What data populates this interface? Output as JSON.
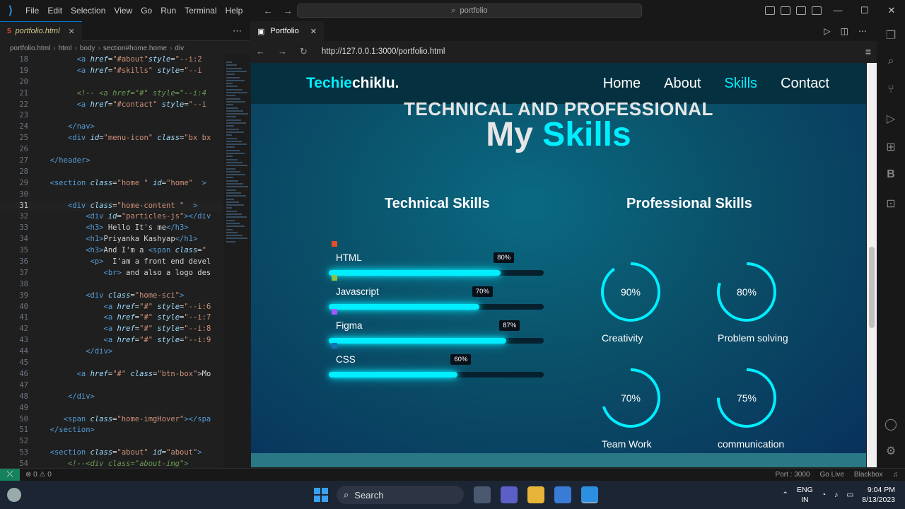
{
  "titlebar": {
    "menu": [
      "File",
      "Edit",
      "Selection",
      "View",
      "Go",
      "Run",
      "Terminal",
      "Help"
    ],
    "search": "portfolio",
    "controls": [
      "—",
      "☐",
      "✕"
    ]
  },
  "editor": {
    "tab": "portfolio.html",
    "breadcrumb": [
      "portfolio.html",
      "html",
      "body",
      "section#home.home",
      "div"
    ],
    "lines": [
      {
        "n": "18",
        "html": "        <span class='tg'>&lt;a</span> <span class='at'>href</span>=<span class='st'>\"#about\"</span><span class='at'>style</span>=<span class='st'>\"--i:2</span>"
      },
      {
        "n": "19",
        "html": "        <span class='tg'>&lt;a</span> <span class='at'>href</span>=<span class='st'>\"#skills\"</span> <span class='at'>style</span>=<span class='st'>\"--i</span>"
      },
      {
        "n": "20",
        "html": ""
      },
      {
        "n": "21",
        "html": "        <span class='cm'>&lt;!-- &lt;a href=\"#\" style=\"--i:4</span>"
      },
      {
        "n": "22",
        "html": "        <span class='tg'>&lt;a</span> <span class='at'>href</span>=<span class='st'>\"#contact\"</span> <span class='at'>style</span>=<span class='st'>\"--i</span>"
      },
      {
        "n": "23",
        "html": ""
      },
      {
        "n": "24",
        "html": "      <span class='tg'>&lt;/nav&gt;</span>"
      },
      {
        "n": "25",
        "html": "      <span class='tg'>&lt;div</span> <span class='at'>id</span>=<span class='st'>\"menu-icon\"</span> <span class='at'>class</span>=<span class='st'>\"bx bx</span>"
      },
      {
        "n": "26",
        "html": ""
      },
      {
        "n": "27",
        "html": "  <span class='tg'>&lt;/header&gt;</span>"
      },
      {
        "n": "28",
        "html": ""
      },
      {
        "n": "29",
        "html": "  <span class='tg'>&lt;section</span> <span class='at'>class</span>=<span class='st'>\"home \"</span> <span class='at'>id</span>=<span class='st'>\"home\"</span>  <span class='tg'>&gt;</span>"
      },
      {
        "n": "30",
        "html": ""
      },
      {
        "n": "31",
        "html": "      <span class='tg'>&lt;div</span> <span class='at'>class</span>=<span class='st'>\"home-content \"</span>  <span class='tg'>&gt;</span>",
        "active": true
      },
      {
        "n": "32",
        "html": "          <span class='tg'>&lt;div</span> <span class='at'>id</span>=<span class='st'>\"particles-js\"</span><span class='tg'>&gt;&lt;/div</span>"
      },
      {
        "n": "33",
        "html": "          <span class='tg'>&lt;h3&gt;</span> Hello It's me<span class='tg'>&lt;/h3&gt;</span>"
      },
      {
        "n": "34",
        "html": "          <span class='tg'>&lt;h1&gt;</span>Priyanka Kashyap<span class='tg'>&lt;/h1&gt;</span>"
      },
      {
        "n": "35",
        "html": "          <span class='tg'>&lt;h3&gt;</span>And I'm a <span class='tg'>&lt;span</span> <span class='at'>class</span>=<span class='st'>\"</span>"
      },
      {
        "n": "36",
        "html": "           <span class='tg'>&lt;p&gt;</span>  I'am a front end devel"
      },
      {
        "n": "37",
        "html": "              <span class='tg'>&lt;br&gt;</span> and also a logo des"
      },
      {
        "n": "38",
        "html": ""
      },
      {
        "n": "39",
        "html": "          <span class='tg'>&lt;div</span> <span class='at'>class</span>=<span class='st'>\"home-sci\"</span><span class='tg'>&gt;</span>"
      },
      {
        "n": "40",
        "html": "              <span class='tg'>&lt;a</span> <span class='at'>href</span>=<span class='st'>\"#\"</span> <span class='at'>style</span>=<span class='st'>\"--i:6</span>"
      },
      {
        "n": "41",
        "html": "              <span class='tg'>&lt;a</span> <span class='at'>href</span>=<span class='st'>\"#\"</span> <span class='at'>style</span>=<span class='st'>\"--i:7</span>"
      },
      {
        "n": "42",
        "html": "              <span class='tg'>&lt;a</span> <span class='at'>href</span>=<span class='st'>\"#\"</span> <span class='at'>style</span>=<span class='st'>\"--i:8</span>"
      },
      {
        "n": "43",
        "html": "              <span class='tg'>&lt;a</span> <span class='at'>href</span>=<span class='st'>\"#\"</span> <span class='at'>style</span>=<span class='st'>\"--i:9</span>"
      },
      {
        "n": "44",
        "html": "          <span class='tg'>&lt;/div&gt;</span>"
      },
      {
        "n": "45",
        "html": ""
      },
      {
        "n": "46",
        "html": "        <span class='tg'>&lt;a</span> <span class='at'>href</span>=<span class='st'>\"#\"</span> <span class='at'>class</span>=<span class='st'>\"btn-box\"</span>&gt;Mo"
      },
      {
        "n": "47",
        "html": ""
      },
      {
        "n": "48",
        "html": "      <span class='tg'>&lt;/div&gt;</span>"
      },
      {
        "n": "49",
        "html": ""
      },
      {
        "n": "50",
        "html": "     <span class='tg'>&lt;span</span> <span class='at'>class</span>=<span class='st'>\"home-imgHover\"</span><span class='tg'>&gt;&lt;/spa</span>"
      },
      {
        "n": "51",
        "html": "  <span class='tg'>&lt;/section&gt;</span>"
      },
      {
        "n": "52",
        "html": ""
      },
      {
        "n": "53",
        "html": "  <span class='tg'>&lt;section</span> <span class='at'>class</span>=<span class='st'>\"about\"</span> <span class='at'>id</span>=<span class='st'>\"about\"</span><span class='tg'>&gt;</span>"
      },
      {
        "n": "54",
        "html": "      <span class='cm'>&lt;!--&lt;div class=\"about-img\"&gt;</span>"
      }
    ]
  },
  "browser": {
    "tab": "Portfolio",
    "url": "http://127.0.0.1:3000/portfolio.html"
  },
  "site": {
    "brand_a": "Techie",
    "brand_b": "chiklu.",
    "nav": [
      {
        "label": "Home",
        "active": false
      },
      {
        "label": "About",
        "active": false
      },
      {
        "label": "Skills",
        "active": true
      },
      {
        "label": "Contact",
        "active": false
      }
    ],
    "subtitle": "TECHNICAL AND PROFESSIONAL",
    "title_a": "My",
    "title_b": "Skills",
    "technical_heading": "Technical Skills",
    "professional_heading": "Professional Skills",
    "technical": [
      {
        "name": "HTML",
        "percent": 80,
        "label": "80%",
        "icon_color": "#e44d26"
      },
      {
        "name": "Javascript",
        "percent": 70,
        "label": "70%",
        "icon_color": "#8bc34a"
      },
      {
        "name": "Figma",
        "percent": 87,
        "label": "87%",
        "icon_color": "#a259ff"
      },
      {
        "name": "CSS",
        "percent": 60,
        "label": "60%",
        "icon_color": "#1572b6"
      }
    ],
    "professional": [
      {
        "name": "Creativity",
        "percent": 90,
        "label": "90%"
      },
      {
        "name": "Problem solving",
        "percent": 80,
        "label": "80%"
      },
      {
        "name": "Team Work",
        "percent": 70,
        "label": "70%"
      },
      {
        "name": "communication",
        "percent": 75,
        "label": "75%"
      }
    ],
    "accent": "#00eeff"
  },
  "status": {
    "problems": "⊗ 0  ⚠ 0",
    "right": [
      "Port : 3000",
      "Go Live",
      "Blackbox"
    ]
  },
  "taskbar": {
    "search": "Search",
    "lang": "ENG",
    "region": "IN",
    "time": "9:04 PM",
    "date": "8/13/2023"
  }
}
